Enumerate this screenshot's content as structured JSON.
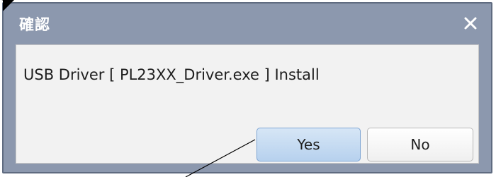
{
  "dialog": {
    "title": "確認",
    "message": "USB Driver [ PL23XX_Driver.exe ] Install",
    "close_icon": "close-icon",
    "buttons": {
      "yes_label": "Yes",
      "no_label": "No"
    }
  },
  "colors": {
    "titlebar": "#8c98ae",
    "content_bg": "#f2f2f2",
    "yes_button": "#c7dcf2",
    "no_button": "#f7f7f7",
    "annotation": "#000000"
  }
}
